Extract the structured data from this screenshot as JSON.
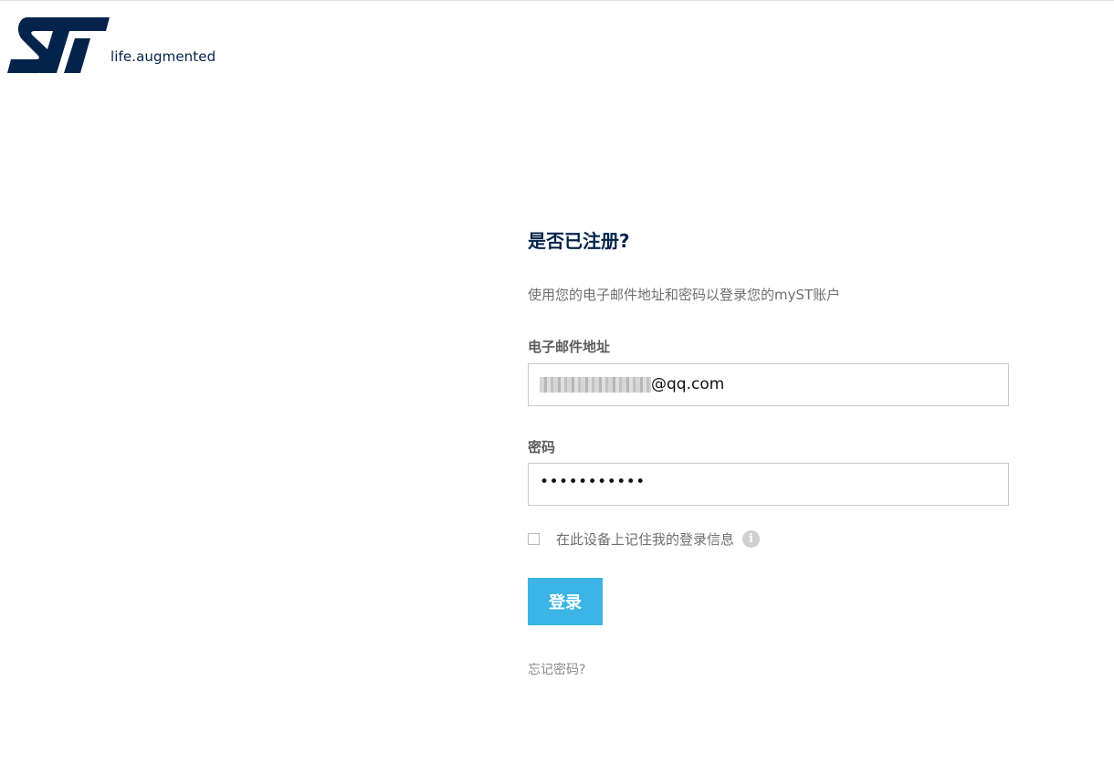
{
  "logo": {
    "tagline": "life.augmented",
    "icon": "st-logo-icon",
    "brand_color": "#03234b"
  },
  "login": {
    "heading": "是否已注册?",
    "subtitle": "使用您的电子邮件地址和密码以登录您的myST账户",
    "email": {
      "label": "电子邮件地址",
      "value_visible_suffix": "@qq.com"
    },
    "password": {
      "label": "密码",
      "masked_value": "•••••••••••"
    },
    "remember_me": {
      "label": "在此设备上记住我的登录信息",
      "checked": false,
      "info_icon": "info-icon",
      "info_symbol": "i"
    },
    "submit_label": "登录",
    "forgot_password": "忘记密码?"
  },
  "colors": {
    "accent": "#3cb4e6",
    "heading": "#03234b",
    "muted_text": "#6f6f6f"
  }
}
